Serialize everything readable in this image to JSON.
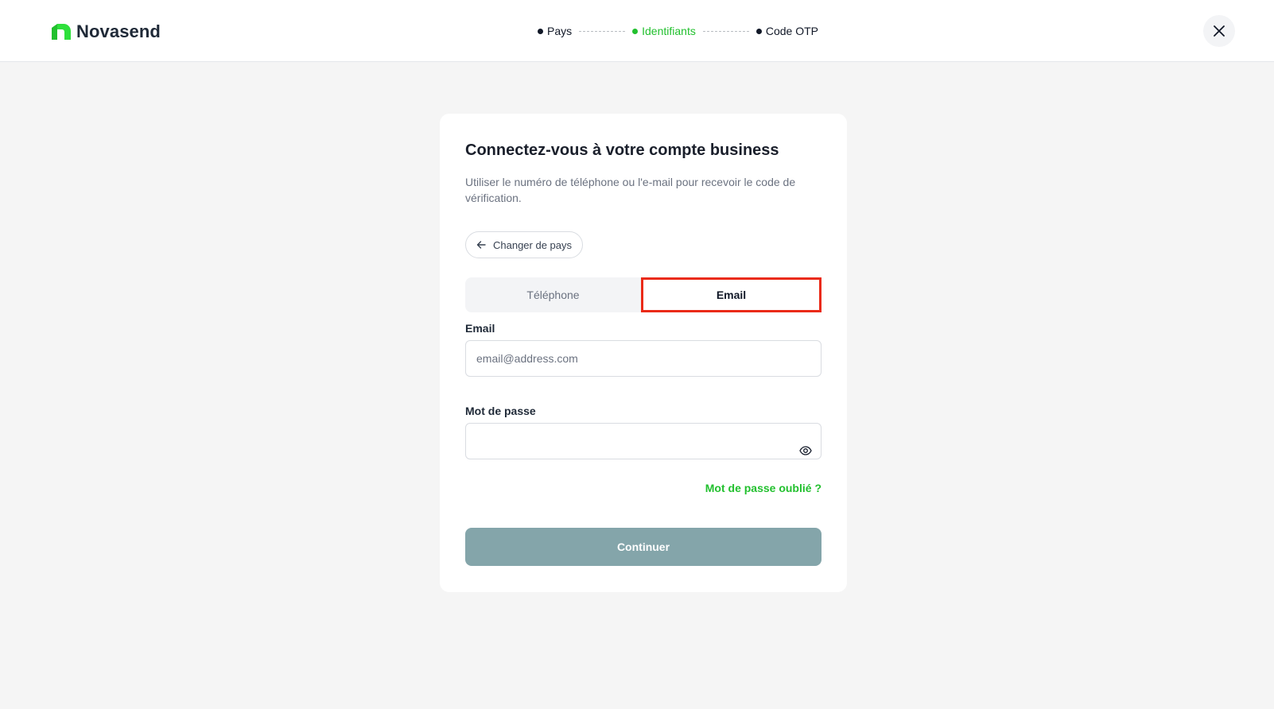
{
  "header": {
    "brand": "Novasend",
    "brand_color": "#22c02e",
    "steps": [
      {
        "label": "Pays",
        "state": "done"
      },
      {
        "label": "Identifiants",
        "state": "active"
      },
      {
        "label": "Code OTP",
        "state": "pending"
      }
    ],
    "close_icon": "close-icon"
  },
  "card": {
    "title": "Connectez-vous à votre compte business",
    "subtitle": "Utiliser le numéro de téléphone ou l'e-mail pour recevoir le code de vérification.",
    "change_country_label": "Changer de pays",
    "tabs": [
      {
        "label": "Téléphone",
        "selected": false
      },
      {
        "label": "Email",
        "selected": true
      }
    ],
    "email": {
      "label": "Email",
      "placeholder": "email@address.com",
      "value": ""
    },
    "password": {
      "label": "Mot de passe",
      "value": "",
      "toggle_icon": "eye-icon"
    },
    "forgot_label": "Mot de passe oublié ?",
    "continue_label": "Continuer",
    "continue_color": "#84a5aa",
    "highlight_color": "#ea2a17"
  }
}
